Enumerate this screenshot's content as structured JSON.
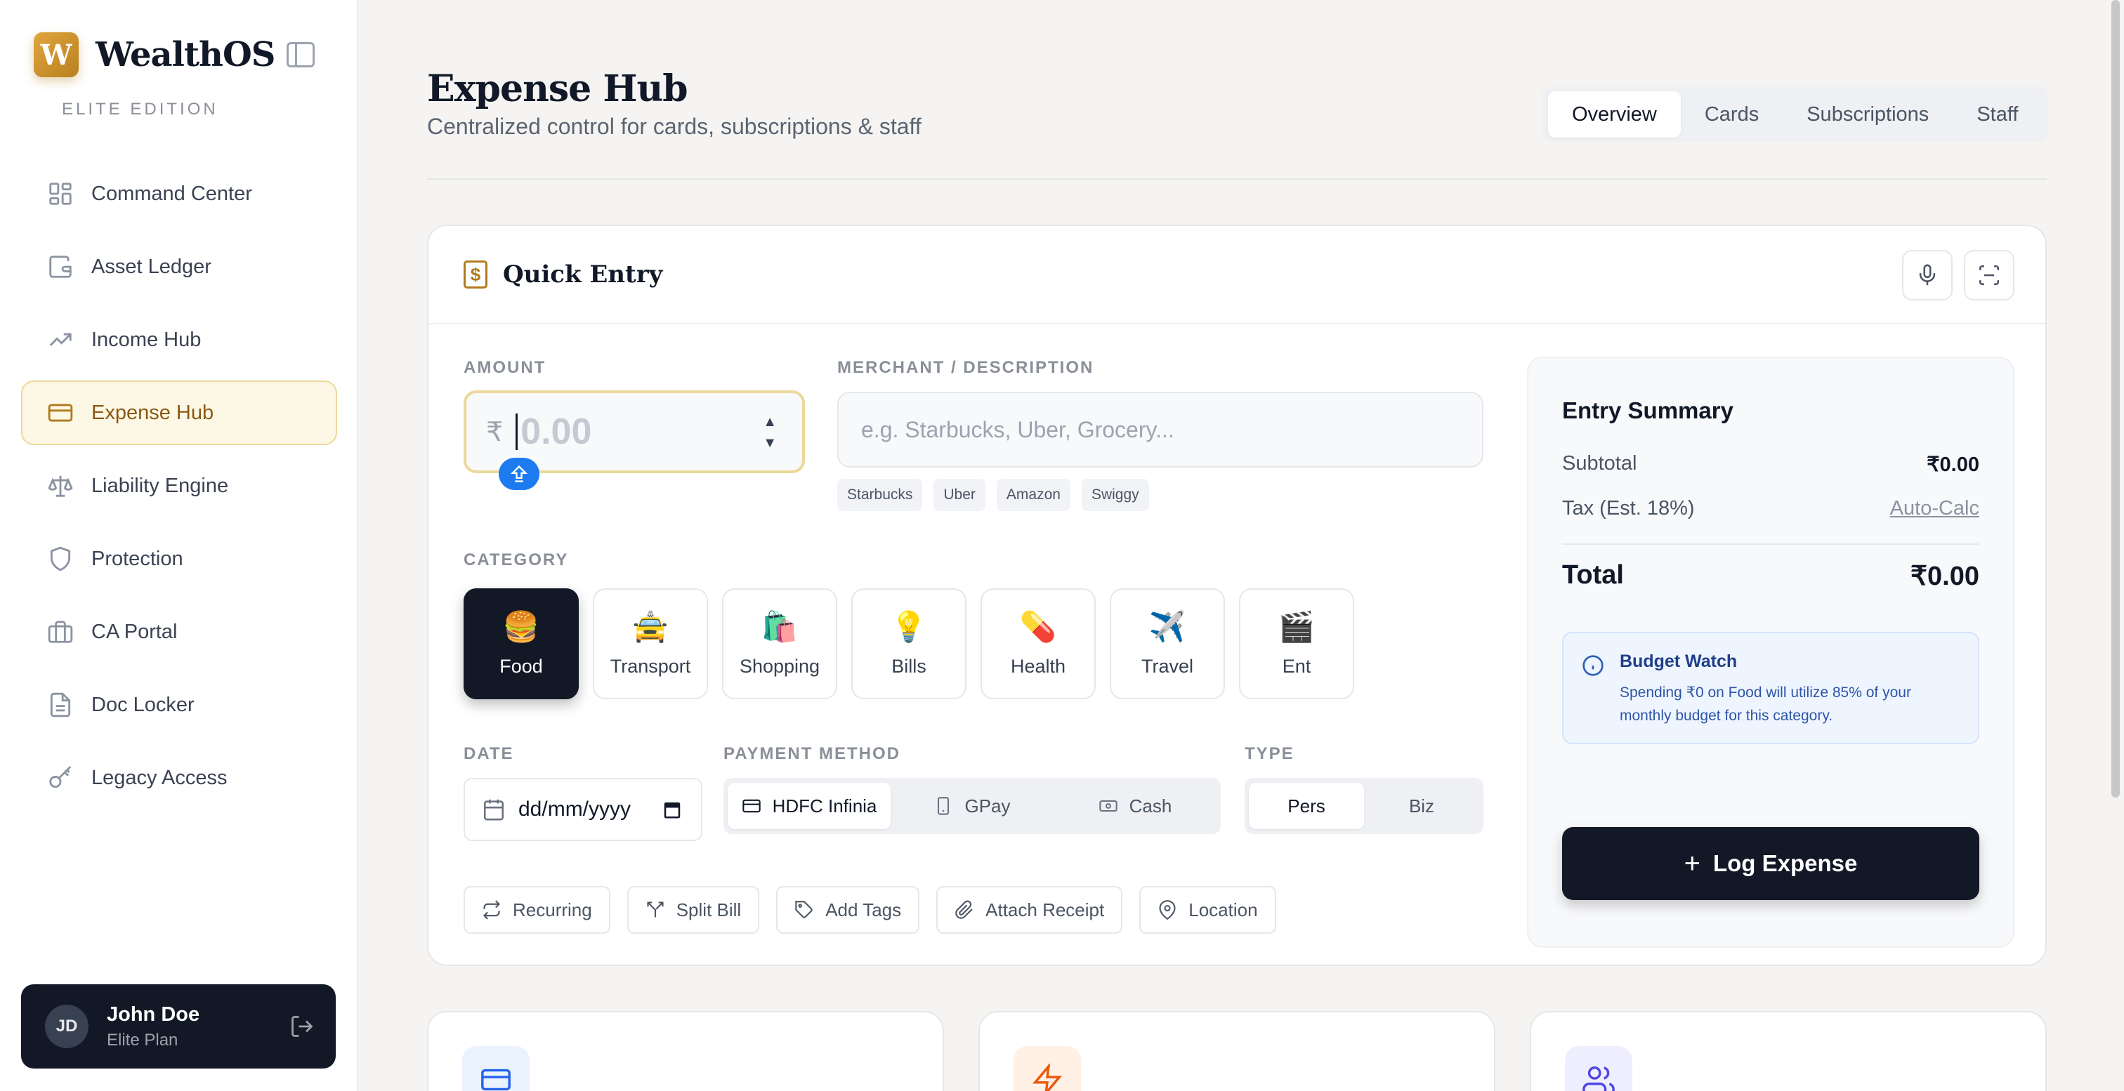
{
  "brand": {
    "logo_letter": "W",
    "name": "WealthOS",
    "edition": "ELITE EDITION",
    "accent": "#b07a1c"
  },
  "sidebar": {
    "items": [
      {
        "label": "Command Center",
        "icon": "grid-icon"
      },
      {
        "label": "Asset Ledger",
        "icon": "wallet-icon"
      },
      {
        "label": "Income Hub",
        "icon": "trending-up-icon"
      },
      {
        "label": "Expense Hub",
        "icon": "credit-card-icon",
        "active": true
      },
      {
        "label": "Liability Engine",
        "icon": "scale-icon"
      },
      {
        "label": "Protection",
        "icon": "shield-icon"
      },
      {
        "label": "CA Portal",
        "icon": "briefcase-icon"
      },
      {
        "label": "Doc Locker",
        "icon": "file-icon"
      },
      {
        "label": "Legacy Access",
        "icon": "key-icon"
      }
    ]
  },
  "user": {
    "initials": "JD",
    "name": "John Doe",
    "plan": "Elite Plan"
  },
  "header": {
    "title": "Expense Hub",
    "subtitle": "Centralized control for cards, subscriptions & staff",
    "tabs": [
      {
        "label": "Overview",
        "active": true
      },
      {
        "label": "Cards"
      },
      {
        "label": "Subscriptions"
      },
      {
        "label": "Staff"
      }
    ]
  },
  "quick_entry": {
    "title": "Quick Entry",
    "amount": {
      "label": "AMOUNT",
      "currency": "₹",
      "placeholder": "0.00",
      "value": ""
    },
    "merchant": {
      "label": "MERCHANT / DESCRIPTION",
      "placeholder": "e.g. Starbucks, Uber, Grocery...",
      "value": ""
    },
    "suggestions": [
      "Starbucks",
      "Uber",
      "Amazon",
      "Swiggy"
    ],
    "category": {
      "label": "CATEGORY",
      "items": [
        {
          "label": "Food",
          "emoji": "🍔",
          "active": true
        },
        {
          "label": "Transport",
          "emoji": "🚖"
        },
        {
          "label": "Shopping",
          "emoji": "🛍️"
        },
        {
          "label": "Bills",
          "emoji": "💡"
        },
        {
          "label": "Health",
          "emoji": "💊"
        },
        {
          "label": "Travel",
          "emoji": "✈️"
        },
        {
          "label": "Ent",
          "emoji": "🎬"
        }
      ]
    },
    "date": {
      "label": "DATE",
      "placeholder": "dd/mm/yyyy"
    },
    "payment": {
      "label": "PAYMENT METHOD",
      "options": [
        {
          "label": "HDFC Infinia",
          "icon": "card-icon",
          "active": true
        },
        {
          "label": "GPay",
          "icon": "phone-icon"
        },
        {
          "label": "Cash",
          "icon": "cash-icon"
        }
      ]
    },
    "type": {
      "label": "TYPE",
      "options": [
        {
          "label": "Pers",
          "active": true
        },
        {
          "label": "Biz"
        }
      ]
    },
    "actions": [
      "Recurring",
      "Split Bill",
      "Add Tags",
      "Attach Receipt",
      "Location"
    ]
  },
  "summary": {
    "title": "Entry Summary",
    "subtotal_label": "Subtotal",
    "subtotal_value": "₹0.00",
    "tax_label": "Tax (Est. 18%)",
    "tax_value": "Auto-Calc",
    "total_label": "Total",
    "total_value": "₹0.00",
    "budget_title": "Budget Watch",
    "budget_text": "Spending ₹0 on Food will utilize 85% of your monthly budget for this category.",
    "log_button": "Log Expense"
  },
  "colors": {
    "dark": "#121826",
    "gold": "#b07a1c",
    "info_blue": "#2f55a6"
  }
}
